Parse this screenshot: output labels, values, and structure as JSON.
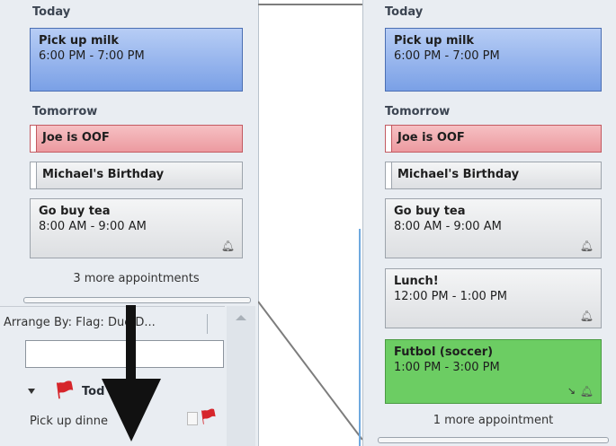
{
  "left": {
    "today_label": "Today",
    "today_appt": {
      "title": "Pick up milk",
      "time": "6:00 PM - 7:00 PM"
    },
    "tomorrow_label": "Tomorrow",
    "oof": "Joe is OOF",
    "birthday": "Michael's Birthday",
    "tea": {
      "title": "Go buy tea",
      "time": "8:00 AM - 9:00 AM"
    },
    "more": "3 more appointments",
    "arrange": "Arrange By: Flag: Due D...",
    "group": "Tod",
    "task": "Pick up dinne"
  },
  "right": {
    "today_label": "Today",
    "today_appt": {
      "title": "Pick up milk",
      "time": "6:00 PM - 7:00 PM"
    },
    "tomorrow_label": "Tomorrow",
    "oof": "Joe is OOF",
    "birthday": "Michael's Birthday",
    "tea": {
      "title": "Go buy tea",
      "time": "8:00 AM - 9:00 AM"
    },
    "lunch": {
      "title": "Lunch!",
      "time": "12:00 PM - 1:00 PM"
    },
    "futbol": {
      "title": "Futbol (soccer)",
      "time": "1:00 PM - 3:00 PM"
    },
    "more": "1 more appointment"
  },
  "icons": {
    "reminder": "bell-icon",
    "flag": "flag-icon",
    "arrow": "down-arrow-annotation",
    "conflict": "conflict-icon"
  },
  "colors": {
    "appointment_blue": "#8fb1ec",
    "oof_red": "#f2a6ab",
    "busy_gray": "#e6e8eb",
    "soccer_green": "#6ccd63",
    "flag_red": "#d6252b"
  }
}
